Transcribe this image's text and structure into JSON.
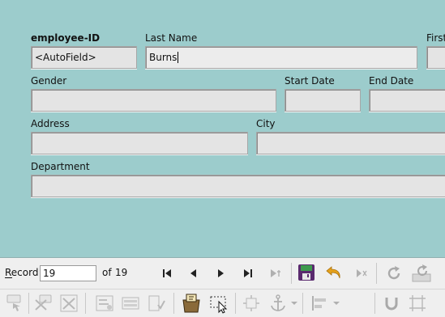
{
  "form": {
    "fields": {
      "employee_id": {
        "label": "employee-ID",
        "value": "<AutoField>"
      },
      "last_name": {
        "label": "Last Name",
        "value": "Burns"
      },
      "first_name": {
        "label": "First",
        "value": ""
      },
      "gender": {
        "label": "Gender",
        "value": ""
      },
      "start_date": {
        "label": "Start Date",
        "value": ""
      },
      "end_date": {
        "label": "End Date",
        "value": ""
      },
      "address": {
        "label": "Address",
        "value": ""
      },
      "city": {
        "label": "City",
        "value": ""
      },
      "department": {
        "label": "Department",
        "value": ""
      }
    },
    "background_color": "#9ccccc"
  },
  "navigation": {
    "record_label": "Record",
    "record_value": "19",
    "of_label": "of",
    "record_count": "19",
    "icons": [
      "first-record-icon",
      "previous-record-icon",
      "next-record-icon",
      "last-record-icon",
      "new-record-icon",
      "save-record-icon",
      "undo-icon",
      "delete-record-icon",
      "refresh-icon",
      "refresh-control-icon"
    ]
  },
  "form_design_toolbar": {
    "icons": [
      "push-button-icon",
      "option-button-icon",
      "design-mode-icon",
      "control-properties-icon",
      "form-properties-icon",
      "activation-order-icon",
      "add-field-icon",
      "form-navigator-icon",
      "select-icon",
      "position-size-icon",
      "anchor-icon",
      "align-icon",
      "snap-to-grid-icon",
      "guides-icon"
    ]
  }
}
